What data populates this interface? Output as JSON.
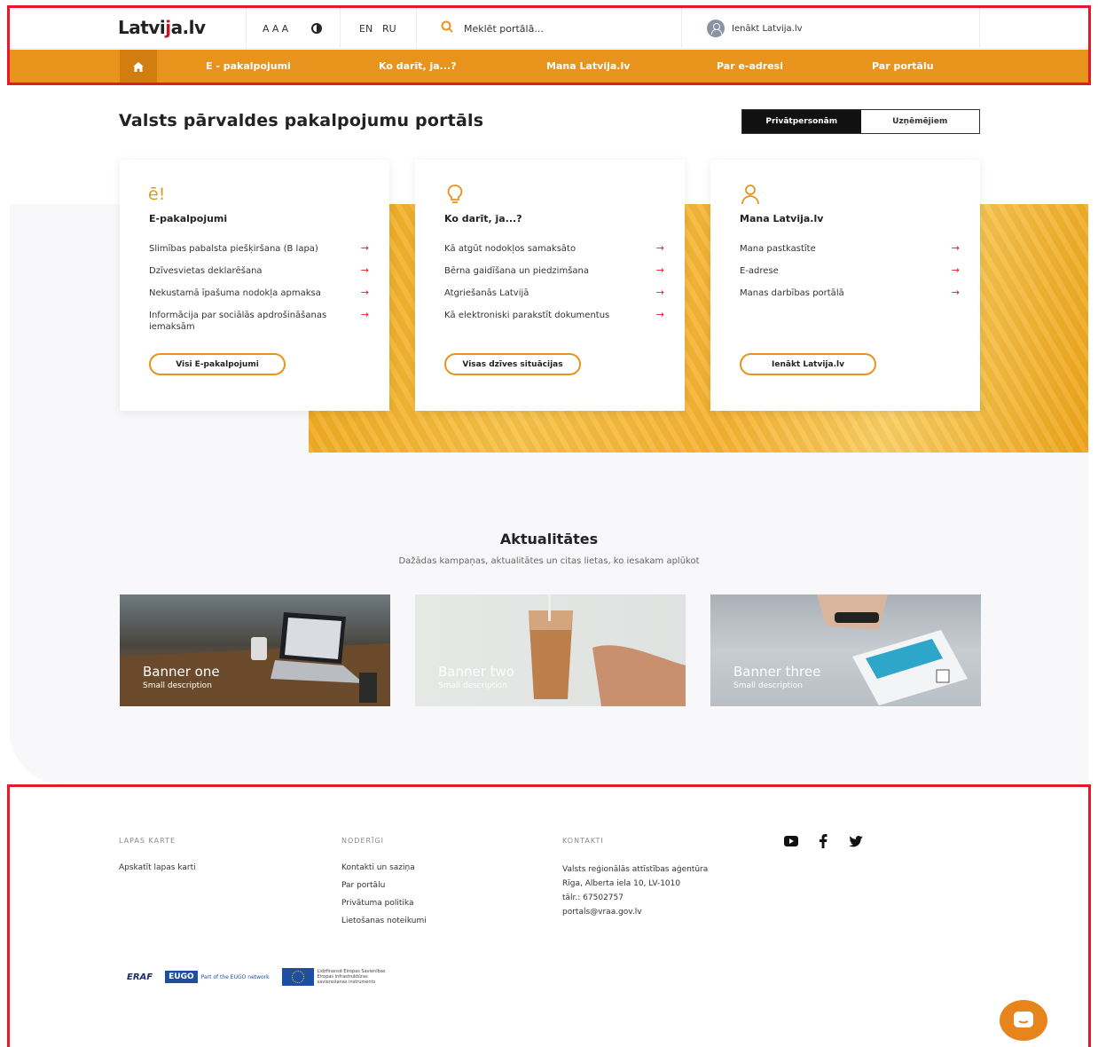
{
  "header": {
    "logo": {
      "pre": "Latvi",
      "mark": "j",
      "post": "a.lv"
    },
    "font_size_label": "AAA",
    "languages": [
      "EN",
      "RU"
    ],
    "search_placeholder": "Meklēt portālā...",
    "login_label": "Ienākt Latvija.lv"
  },
  "nav": {
    "items": [
      "E - pakalpojumi",
      "Ko darīt, ja...?",
      "Mana Latvija.lv",
      "Par e-adresi",
      "Par portālu"
    ]
  },
  "main": {
    "title": "Valsts pārvaldes pakalpojumu portāls",
    "audience_toggle": [
      "Privātpersonām",
      "Uzņēmējiem"
    ],
    "cards": [
      {
        "icon_text": "ē!",
        "title": "E-pakalpojumi",
        "links": [
          "Slimības pabalsta piešķiršana (B lapa)",
          "Dzīvesvietas deklarēšana",
          "Nekustamā īpašuma nodokļa apmaksa",
          "Informācija par sociālās apdrošināšanas iemaksām"
        ],
        "button": "Visi E-pakalpojumi"
      },
      {
        "title": "Ko darīt, ja...?",
        "links": [
          "Kā atgūt nodokļos samaksāto",
          "Bērna gaidīšana un piedzimšana",
          "Atgriešanās Latvijā",
          "Kā elektroniski parakstīt dokumentus"
        ],
        "button": "Visas dzīves situācijas"
      },
      {
        "title": "Mana Latvija.lv",
        "links": [
          "Mana pastkastīte",
          "E-adrese",
          "Manas darbības portālā"
        ],
        "button": "Ienākt Latvija.lv"
      }
    ],
    "arrow": "→"
  },
  "news": {
    "title": "Aktualitātes",
    "subtitle": "Dažādas kampaņas, aktualitātes un citas lietas, ko iesakam aplūkot",
    "banners": [
      {
        "title": "Banner one",
        "description": "Small description"
      },
      {
        "title": "Banner two",
        "description": "Small description"
      },
      {
        "title": "Banner three",
        "description": "Small description"
      }
    ]
  },
  "footer": {
    "sitemap": {
      "heading": "LAPAS KARTE",
      "links": [
        "Apskatīt lapas karti"
      ]
    },
    "useful": {
      "heading": "NODERĪGI",
      "links": [
        "Kontakti un saziņa",
        "Par portālu",
        "Privātuma politika",
        "Lietošanas noteikumi"
      ]
    },
    "contacts": {
      "heading": "KONTAKTI",
      "lines": [
        "Valsts reģionālās attīstības aģentūra",
        "Rīga, Alberta iela 10, LV-1010",
        "tālr.: 67502757",
        "portals@vraa.gov.lv"
      ]
    },
    "social": [
      "youtube-icon",
      "facebook-icon",
      "twitter-icon"
    ],
    "partner_logos": {
      "eraf": "ERAF",
      "eugo": "EUGO",
      "eugo_note": "Part of the EUGO network",
      "eu_note": "Līdzfinansē Eiropas Savienības Eiropas Infrastruktūras savienošanas instruments"
    }
  },
  "colors": {
    "accent": "#e8941c",
    "red": "#e8182b",
    "dark": "#111111"
  }
}
